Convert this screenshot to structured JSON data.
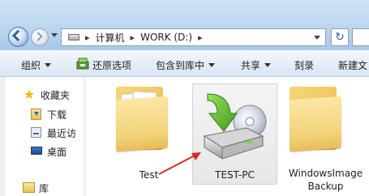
{
  "address_bar": {
    "separator": "▸",
    "breadcrumbs": [
      "计算机",
      "WORK (D:)"
    ]
  },
  "toolbar": {
    "organize": "组织",
    "restore_options": "还原选项",
    "include_in_library": "包含到库中",
    "share": "共享",
    "burn": "刻录",
    "new_folder": "新建文"
  },
  "nav_pane": {
    "favorites": "收藏夹",
    "downloads": "下载",
    "recent": "最近访",
    "desktop": "桌面",
    "libraries": "库"
  },
  "files": [
    {
      "name": "Test",
      "type": "folder"
    },
    {
      "name": "TEST-PC",
      "type": "backup",
      "selected": true
    },
    {
      "name_line1": "WindowsImage",
      "name_line2": "Backup",
      "type": "folder"
    }
  ],
  "colors": {
    "titlebar": "#bcd6ef",
    "folder": "#f3d27a",
    "annotation_arrow": "#d9282a",
    "backup_arrow": "#5fb52f"
  }
}
